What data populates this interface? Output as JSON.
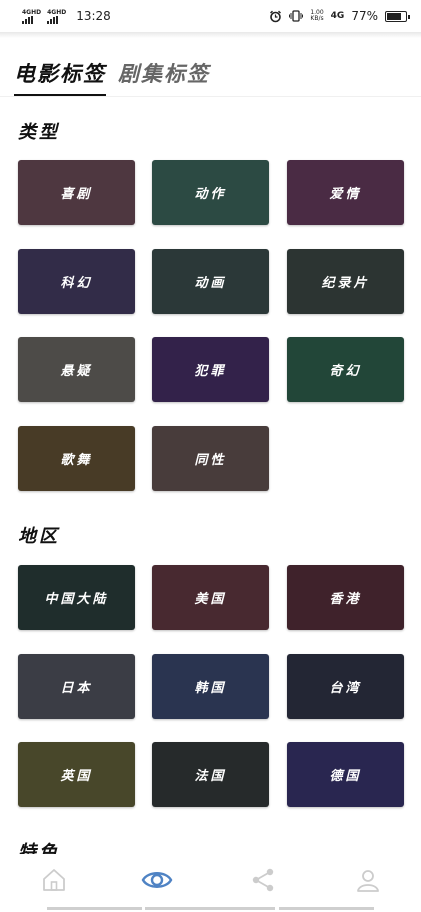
{
  "status_bar": {
    "sim1": "4GHD",
    "sim2": "4GHD",
    "time": "13:28",
    "speed_value": "1.00",
    "speed_unit": "KB/s",
    "net": "4G",
    "battery": "77%",
    "battery_level": 0.77
  },
  "tabs": [
    {
      "label": "电影标签",
      "active": true
    },
    {
      "label": "剧集标签",
      "active": false
    }
  ],
  "sections": [
    {
      "title": "类型",
      "tiles": [
        {
          "label": "喜剧",
          "color": "#4e3740"
        },
        {
          "label": "动作",
          "color": "#2c4a43"
        },
        {
          "label": "爱情",
          "color": "#4a2b44"
        },
        {
          "label": "科幻",
          "color": "#322c48"
        },
        {
          "label": "动画",
          "color": "#2b3838"
        },
        {
          "label": "纪录片",
          "color": "#2c3432"
        },
        {
          "label": "悬疑",
          "color": "#4d4b48"
        },
        {
          "label": "犯罪",
          "color": "#33224a"
        },
        {
          "label": "奇幻",
          "color": "#224638"
        },
        {
          "label": "歌舞",
          "color": "#483b26"
        },
        {
          "label": "同性",
          "color": "#483c3b"
        }
      ]
    },
    {
      "title": "地区",
      "tiles": [
        {
          "label": "中国大陆",
          "color": "#1f2d2c"
        },
        {
          "label": "美国",
          "color": "#482930"
        },
        {
          "label": "香港",
          "color": "#3f222b"
        },
        {
          "label": "日本",
          "color": "#3b3d45"
        },
        {
          "label": "韩国",
          "color": "#2a3450"
        },
        {
          "label": "台湾",
          "color": "#232634"
        },
        {
          "label": "英国",
          "color": "#48472a"
        },
        {
          "label": "法国",
          "color": "#262a2b"
        },
        {
          "label": "德国",
          "color": "#292650"
        }
      ]
    },
    {
      "title": "特色",
      "tiles": []
    }
  ],
  "bottom_nav": [
    {
      "icon": "home-icon",
      "active": false
    },
    {
      "icon": "eye-icon",
      "active": true
    },
    {
      "icon": "share-icon",
      "active": false
    },
    {
      "icon": "user-icon",
      "active": false
    }
  ],
  "colors": {
    "accent": "#4f83c4",
    "nav_inactive": "#cccccc"
  }
}
